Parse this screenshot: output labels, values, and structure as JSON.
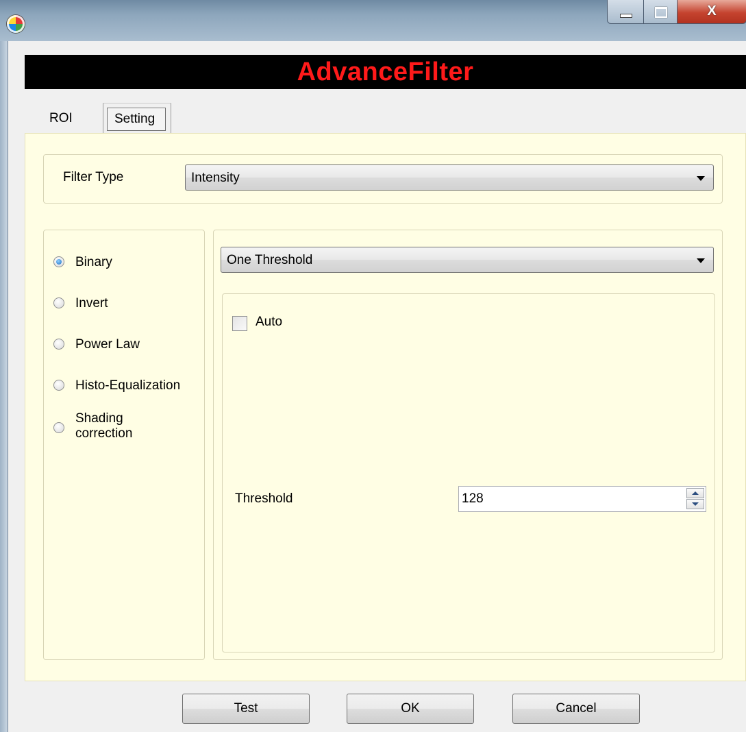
{
  "window": {
    "app_icon": "colorful-app-icon",
    "controls": {
      "minimize": "minimize-icon",
      "maximize": "maximize-icon",
      "close": "X"
    }
  },
  "banner": {
    "title": "AdvanceFilter",
    "title_color": "#ff1a1a",
    "background": "#000000"
  },
  "tabs": [
    {
      "label": "ROI",
      "selected": false
    },
    {
      "label": "Setting",
      "selected": true
    }
  ],
  "setting": {
    "filter_type": {
      "label": "Filter Type",
      "value": "Intensity"
    },
    "modes": [
      {
        "label": "Binary",
        "checked": true
      },
      {
        "label": "Invert",
        "checked": false
      },
      {
        "label": "Power Law",
        "checked": false
      },
      {
        "label": "Histo-Equalization",
        "checked": false
      },
      {
        "label": "Shading\ncorrection",
        "checked": false
      }
    ],
    "threshold_mode": {
      "value": "One Threshold"
    },
    "auto": {
      "label": "Auto",
      "checked": false
    },
    "threshold": {
      "label": "Threshold",
      "value": "128"
    }
  },
  "buttons": {
    "test": "Test",
    "ok": "OK",
    "cancel": "Cancel"
  },
  "colors": {
    "panel_background": "#fffee4",
    "window_background": "#f0f0f0"
  }
}
